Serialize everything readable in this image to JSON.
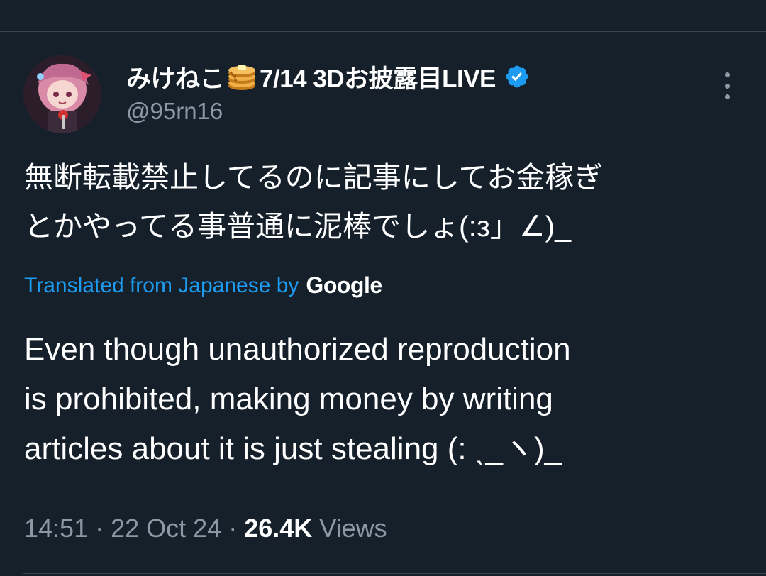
{
  "tweet": {
    "author": {
      "display_name_part1": "みけねこ",
      "emoji_icon": "pancakes-emoji",
      "display_name_part2": "7/14 3Dお披露目LIVE",
      "verified_icon": "verified-badge-icon",
      "handle": "@95rn16"
    },
    "more_icon": "more-vertical-icon",
    "original_lines": [
      "無断転載禁止してるのに記事にしてお金稼ぎ",
      "とかやってる事普通に泥棒でしょ(:з」∠)_"
    ],
    "translated_from": "Translated from Japanese by",
    "translator": "Google",
    "translation_lines": [
      "Even though unauthorized reproduction",
      "is prohibited, making money by writing",
      "articles about it is just stealing (: ˎ_ヽ)_"
    ],
    "meta": {
      "time": "14:51",
      "sep1": " · ",
      "date": "22 Oct 24",
      "sep2": " · ",
      "views_count": "26.4K",
      "views_label": " Views"
    }
  },
  "colors": {
    "background": "#15202b",
    "text_primary": "#ffffff",
    "text_secondary": "#8b98a5",
    "accent": "#1d9bf0",
    "divider": "#38444d"
  }
}
